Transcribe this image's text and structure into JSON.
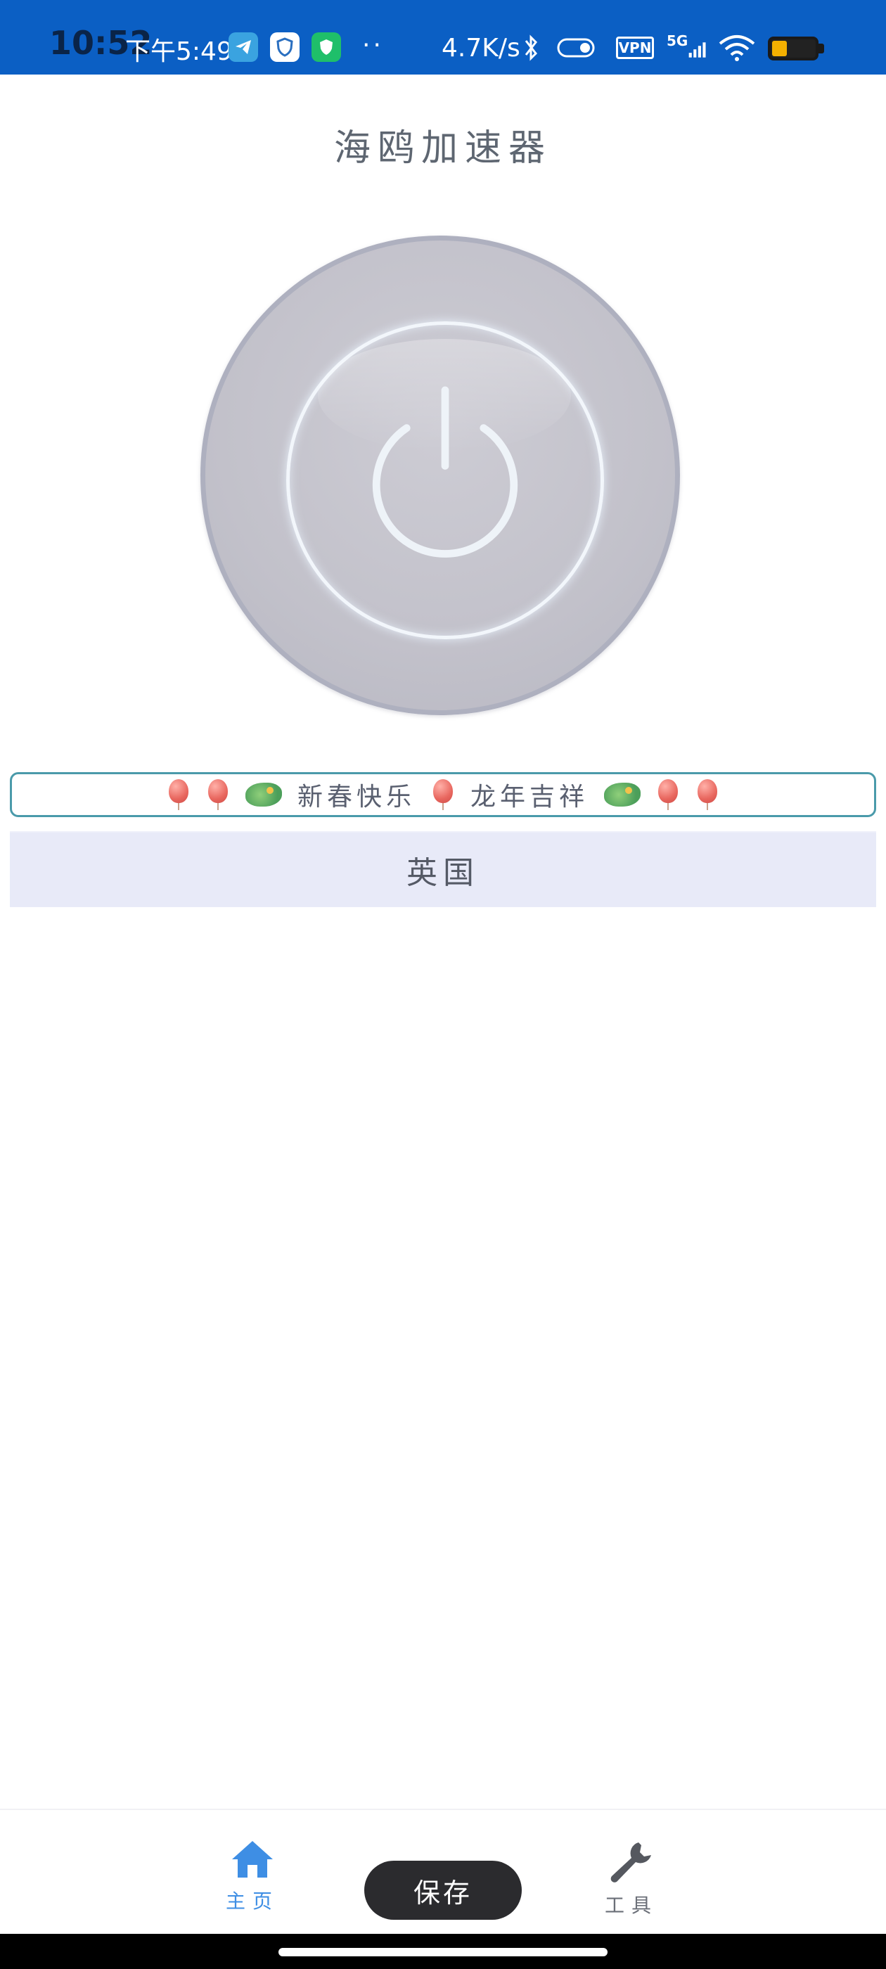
{
  "status_bar": {
    "time_primary": "10:52",
    "time_secondary": "下午5:49",
    "overflow_dots": "··",
    "network_speed": "4.7K/s",
    "vpn_label": "VPN",
    "network_type": "5G",
    "battery_level": 0.35,
    "background_color": "#0b5fc4"
  },
  "header": {
    "title": "海鸥加速器"
  },
  "power_button": {
    "icon": "power-icon",
    "ring_color": "#f2f6fb",
    "disc_color": "#c2c1ca"
  },
  "banner": {
    "text_1": "新春快乐",
    "text_2": "龙年吉祥",
    "decorations": [
      "balloon-icon",
      "balloon-icon",
      "dragon-icon",
      "balloon-icon",
      "dragon-icon",
      "balloon-icon",
      "balloon-icon"
    ],
    "border_color": "#4a9aaa"
  },
  "region_selector": {
    "label": "英国",
    "background_color": "#e8eaf8"
  },
  "bottom_nav": {
    "home_label": "主页",
    "tools_label": "工具",
    "home_icon": "home-icon",
    "tools_icon": "wrench-icon",
    "active_color": "#3e8ee4"
  },
  "save_button": {
    "label": "保存"
  }
}
